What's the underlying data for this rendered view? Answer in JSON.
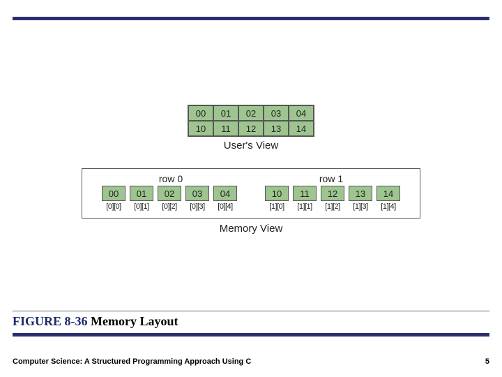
{
  "users_view": {
    "rows": [
      [
        "00",
        "01",
        "02",
        "03",
        "04"
      ],
      [
        "10",
        "11",
        "12",
        "13",
        "14"
      ]
    ],
    "label": "User's View"
  },
  "memory_view": {
    "group_headers": [
      "row 0",
      "row 1"
    ],
    "cells": [
      "00",
      "01",
      "02",
      "03",
      "04",
      "10",
      "11",
      "12",
      "13",
      "14"
    ],
    "indices": [
      "[0][0]",
      "[0][1]",
      "[0][2]",
      "[0][3]",
      "[0][4]",
      "[1][0]",
      "[1][1]",
      "[1][2]",
      "[1][3]",
      "[1][4]"
    ],
    "label": "Memory View"
  },
  "caption": {
    "fig_number": "FIGURE 8-36",
    "fig_title": "  Memory Layout"
  },
  "footer": {
    "left": "Computer Science: A Structured Programming Approach Using C",
    "right": "5"
  }
}
